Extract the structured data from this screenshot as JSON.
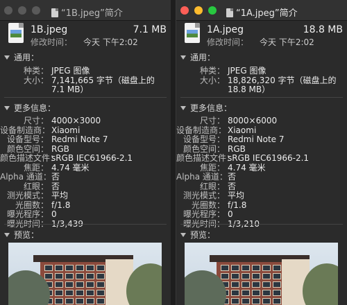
{
  "left": {
    "title": "“1B.jpeg”简介",
    "filename": "1B.jpeg",
    "size": "7.1 MB",
    "modified_label": "修改时间：",
    "modified_value": "今天 下午2:02",
    "general_header": "通用：",
    "more_header": "更多信息：",
    "preview_header": "预览：",
    "general": [
      {
        "k": "种类：",
        "v": "JPEG 图像"
      },
      {
        "k": "大小：",
        "v": "7,141,665 字节（磁盘上的"
      },
      {
        "k": "",
        "v": "7.1 MB）"
      }
    ],
    "more": [
      {
        "k": "尺寸：",
        "v": "4000×3000"
      },
      {
        "k": "设备制造商：",
        "v": "Xiaomi"
      },
      {
        "k": "设备型号：",
        "v": "Redmi Note 7"
      },
      {
        "k": "颜色空间：",
        "v": "RGB"
      },
      {
        "k": "颜色描述文件：",
        "v": "sRGB IEC61966-2.1"
      },
      {
        "k": "焦距：",
        "v": "4.74 毫米"
      },
      {
        "k": "Alpha 通道：",
        "v": "否"
      },
      {
        "k": "红眼：",
        "v": "否"
      },
      {
        "k": "测光模式：",
        "v": "平均"
      },
      {
        "k": "光圈数：",
        "v": "f/1.8"
      },
      {
        "k": "曝光程序：",
        "v": "0"
      },
      {
        "k": "曝光时间：",
        "v": "1/3,439"
      }
    ]
  },
  "right": {
    "title": "“1A.jpeg”简介",
    "filename": "1A.jpeg",
    "size": "18.8 MB",
    "modified_label": "修改时间：",
    "modified_value": "今天 下午2:02",
    "general_header": "通用：",
    "more_header": "更多信息：",
    "preview_header": "预览：",
    "general": [
      {
        "k": "种类：",
        "v": "JPEG 图像"
      },
      {
        "k": "大小：",
        "v": "18,826,320 字节（磁盘上的"
      },
      {
        "k": "",
        "v": "18.8 MB）"
      }
    ],
    "more": [
      {
        "k": "尺寸：",
        "v": "8000×6000"
      },
      {
        "k": "设备制造商：",
        "v": "Xiaomi"
      },
      {
        "k": "设备型号：",
        "v": "Redmi Note 7"
      },
      {
        "k": "颜色空间：",
        "v": "RGB"
      },
      {
        "k": "颜色描述文件：",
        "v": "sRGB IEC61966-2.1"
      },
      {
        "k": "焦距：",
        "v": "4.74 毫米"
      },
      {
        "k": "Alpha 通道：",
        "v": "否"
      },
      {
        "k": "红眼：",
        "v": "否"
      },
      {
        "k": "测光模式：",
        "v": "平均"
      },
      {
        "k": "光圈数：",
        "v": "f/1.8"
      },
      {
        "k": "曝光程序：",
        "v": "0"
      },
      {
        "k": "曝光时间：",
        "v": "1/3,210"
      }
    ]
  },
  "icons": {
    "close": "close-button",
    "minimize": "minimize-button",
    "zoom": "zoom-button",
    "file": "jpeg-file-icon",
    "disclosure": "disclosure-triangle-icon"
  },
  "colors": {
    "close": "#fe5f57",
    "minimize": "#febc2e",
    "zoom": "#28c840",
    "inactive_light": "#5a5a5a",
    "window_bg": "#2b2b2b"
  }
}
